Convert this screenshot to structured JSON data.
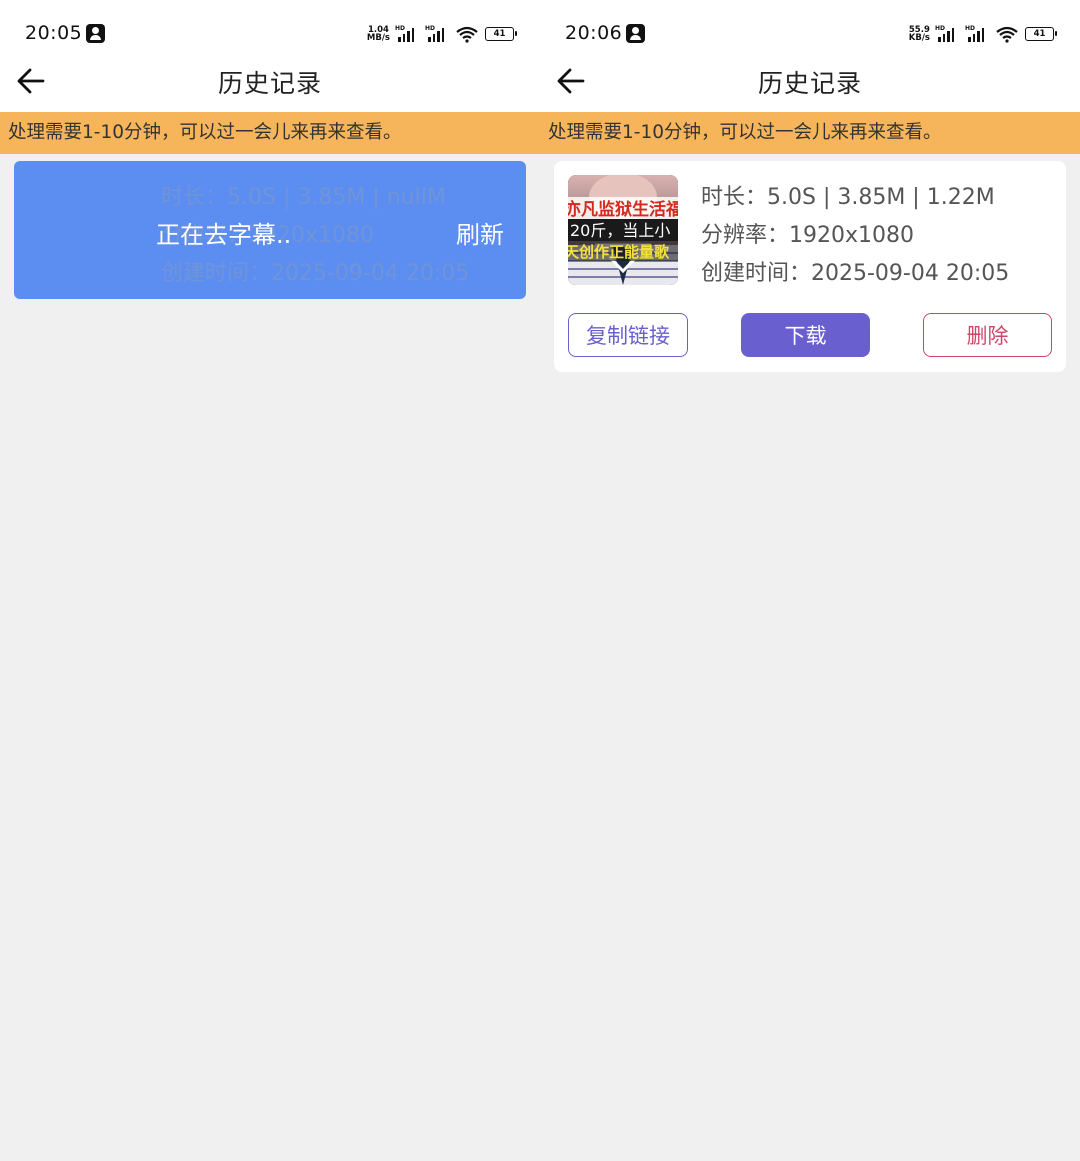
{
  "left": {
    "status": {
      "time": "20:05",
      "net_speed_value": "1.04",
      "net_speed_unit": "MB/s",
      "hd1": "HD",
      "hd2": "HD",
      "battery": "41"
    },
    "nav": {
      "title": "历史记录"
    },
    "notice": "处理需要1-10分钟，可以过一会儿来再来查看。",
    "card": {
      "faint_duration": "时长：5.0S | 3.85M | nullM",
      "faint_resolution": "分辨率：1920x1080",
      "faint_created": "创建时间：2025-09-04 20:05",
      "processing": "正在去字幕..",
      "refresh": "刷新"
    }
  },
  "right": {
    "status": {
      "time": "20:06",
      "net_speed_value": "55.9",
      "net_speed_unit": "KB/s",
      "hd1": "HD",
      "hd2": "HD",
      "battery": "41"
    },
    "nav": {
      "title": "历史记录"
    },
    "notice": "处理需要1-10分钟，可以过一会儿来再来查看。",
    "card": {
      "duration": "时长：5.0S | 3.85M | 1.22M",
      "resolution": "分辨率：1920x1080",
      "created": "创建时间：2025-09-04 20:05",
      "thumb_line1": "亦凡监狱生活福",
      "thumb_line2": "20斤，当上小",
      "thumb_line3": "天创作正能量歌",
      "copy_link": "复制链接",
      "download": "下载",
      "delete": "删除"
    }
  },
  "colors": {
    "notice_bg": "#f6b55b",
    "processing_card": "#5b8ef0",
    "primary": "#6a5fcf",
    "danger": "#d0456a"
  },
  "icons": [
    "back-arrow-icon",
    "signal-icon",
    "wifi-icon",
    "battery-icon",
    "app-notification-icon"
  ]
}
